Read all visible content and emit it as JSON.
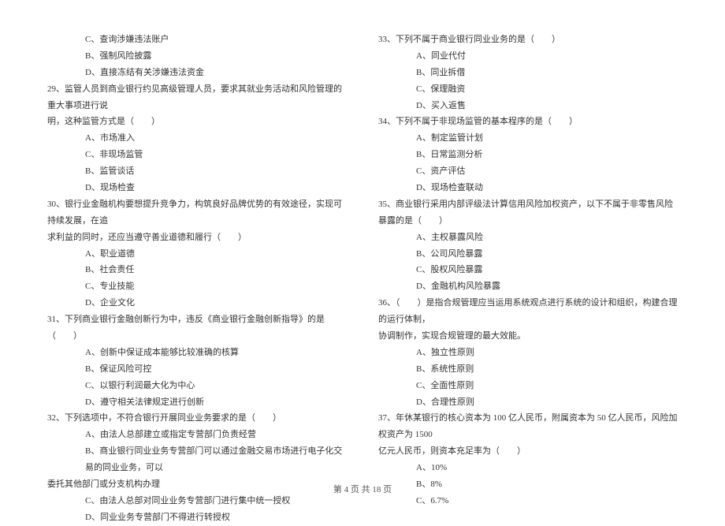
{
  "left": {
    "q28_opts": [
      {
        "label": "C、",
        "text": "查询涉嫌违法账户"
      },
      {
        "label": "B、",
        "text": "强制风险披露"
      },
      {
        "label": "D、",
        "text": "直接冻结有关涉嫌违法资金"
      }
    ],
    "q29": {
      "num": "29、",
      "line1": "监管人员到商业银行约见高级管理人员，要求其就业务活动和风险管理的重大事项进行说",
      "line2": "明，这种监管方式是（　　）",
      "opts": [
        {
          "label": "A、",
          "text": "市场准入"
        },
        {
          "label": "C、",
          "text": "非现场监管"
        },
        {
          "label": "B、",
          "text": "监管谈话"
        },
        {
          "label": "D、",
          "text": "现场检查"
        }
      ]
    },
    "q30": {
      "num": "30、",
      "line1": "银行业金融机构要想提升竞争力，构筑良好品牌优势的有效途径，实现可持续发展，在追",
      "line2": "求利益的同时，还应当遵守善业道德和履行（　　）",
      "opts": [
        {
          "label": "A、",
          "text": "职业道德"
        },
        {
          "label": "B、",
          "text": "社会责任"
        },
        {
          "label": "C、",
          "text": "专业技能"
        },
        {
          "label": "D、",
          "text": "企业文化"
        }
      ]
    },
    "q31": {
      "num": "31、",
      "line1": "下列商业银行金融创新行为中，违反《商业银行金融创新指导》的是（　　）",
      "opts": [
        {
          "label": "A、",
          "text": "创新中保证成本能够比较准确的核算"
        },
        {
          "label": "B、",
          "text": "保证风险可控"
        },
        {
          "label": "C、",
          "text": "以银行利润最大化为中心"
        },
        {
          "label": "D、",
          "text": "遵守相关法律规定进行创新"
        }
      ]
    },
    "q32": {
      "num": "32、",
      "line1": "下列选项中，不符合银行开展同业业务要求的是（　　）",
      "opts": [
        {
          "label": "A、",
          "text": "由法人总部建立或指定专营部门负责经营"
        },
        {
          "label": "B、",
          "text": "商业银行同业业务专营部门可以通过金融交易市场进行电子化交易的同业业务，可以",
          "cont": "委托其他部门或分支机构办理"
        },
        {
          "label": "C、",
          "text": "由法人总部对同业业务专营部门进行集中统一授权"
        },
        {
          "label": "D、",
          "text": "同业业务专营部门不得进行转授权"
        }
      ]
    }
  },
  "right": {
    "q33": {
      "num": "33、",
      "line1": "下列不属于商业银行同业业务的是（　　）",
      "opts": [
        {
          "label": "A、",
          "text": "同业代付"
        },
        {
          "label": "B、",
          "text": "同业拆借"
        },
        {
          "label": "C、",
          "text": "保理融资"
        },
        {
          "label": "D、",
          "text": "买入返售"
        }
      ]
    },
    "q34": {
      "num": "34、",
      "line1": "下列不属于非现场监管的基本程序的是（　　）",
      "opts": [
        {
          "label": "A、",
          "text": "制定监管计划"
        },
        {
          "label": "B、",
          "text": "日常监测分析"
        },
        {
          "label": "C、",
          "text": "资产评估"
        },
        {
          "label": "D、",
          "text": "现场检查联动"
        }
      ]
    },
    "q35": {
      "num": "35、",
      "line1": "商业银行采用内部评级法计算信用风险加权资产，以下不属于非零售风险暴露的是（　　）",
      "opts": [
        {
          "label": "A、",
          "text": "主权暴露风险"
        },
        {
          "label": "B、",
          "text": "公司风险暴露"
        },
        {
          "label": "C、",
          "text": "股权风险暴露"
        },
        {
          "label": "D、",
          "text": "金融机构风险暴露"
        }
      ]
    },
    "q36": {
      "num": "36、",
      "line1": "（　　）是指合规管理应当运用系统观点进行系统的设计和组织，构建合理的运行体制，",
      "line2": "协调制作，实现合规管理的最大效能。",
      "opts": [
        {
          "label": "A、",
          "text": "独立性原则"
        },
        {
          "label": "B、",
          "text": "系统性原则"
        },
        {
          "label": "C、",
          "text": "全面性原则"
        },
        {
          "label": "D、",
          "text": "合理性原则"
        }
      ]
    },
    "q37": {
      "num": "37、",
      "line1": "年休某银行的核心资本为 100 亿人民币，附属资本为 50 亿人民币，风险加权资产为 1500",
      "line2": "亿元人民币，则资本充足率为（　　）",
      "opts": [
        {
          "label": "A、",
          "text": "10%"
        },
        {
          "label": "B、",
          "text": "8%"
        },
        {
          "label": "C、",
          "text": "6.7%"
        }
      ]
    }
  },
  "footer": "第 4 页 共 18 页"
}
